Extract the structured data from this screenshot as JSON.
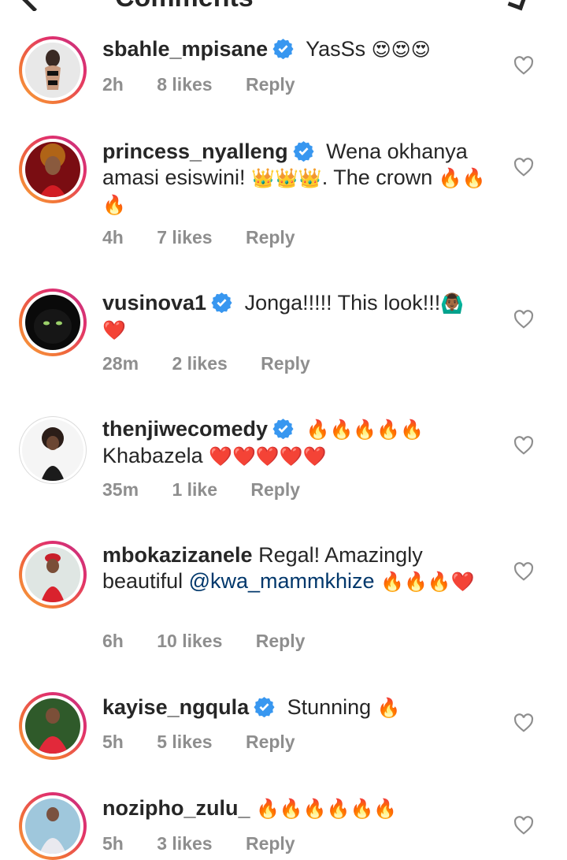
{
  "header": {
    "title": "Comments"
  },
  "comments": [
    {
      "username": "sbahle_mpisane",
      "verified": true,
      "text": "YasSs",
      "emojis": "😍😍😍",
      "time": "2h",
      "likes": "8 likes",
      "reply": "Reply"
    },
    {
      "username": "princess_nyalleng",
      "verified": true,
      "text_1": "Wena okhanya amasi esiswini! ",
      "emojis_1": "👑👑👑",
      "text_2": ". The crown ",
      "emojis_2": "🔥🔥🔥",
      "time": "4h",
      "likes": "7 likes",
      "reply": "Reply"
    },
    {
      "username": "vusinova1",
      "verified": true,
      "text": "Jonga!!!!! This look!!!",
      "emojis": "🙆🏾‍♂️❤️",
      "time": "28m",
      "likes": "2 likes",
      "reply": "Reply"
    },
    {
      "username": "thenjiwecomedy",
      "verified": true,
      "emojis_1": "🔥🔥🔥🔥🔥",
      "text": "Khabazela ",
      "emojis_2": "❤️❤️❤️❤️❤️",
      "time": "35m",
      "likes": "1 like",
      "reply": "Reply"
    },
    {
      "username": "mbokazizanele",
      "verified": false,
      "text": "Regal! Amazingly beautiful ",
      "mention": "@kwa_mammkhize",
      "emojis": "🔥🔥🔥❤️",
      "time": "6h",
      "likes": "10 likes",
      "reply": "Reply"
    },
    {
      "username": "kayise_ngqula",
      "verified": true,
      "text": "Stunning ",
      "emojis": "🔥",
      "time": "5h",
      "likes": "5 likes",
      "reply": "Reply"
    },
    {
      "username": "nozipho_zulu_",
      "verified": false,
      "emojis": "🔥🔥🔥🔥🔥🔥",
      "time": "5h",
      "likes": "3 likes",
      "reply": "Reply"
    }
  ],
  "colors": {
    "text": "#262626",
    "meta": "#8e8e8e",
    "mention": "#00376b",
    "verified": "#3897f0",
    "ring_start": "#f9a43c",
    "ring_end": "#c13584"
  }
}
